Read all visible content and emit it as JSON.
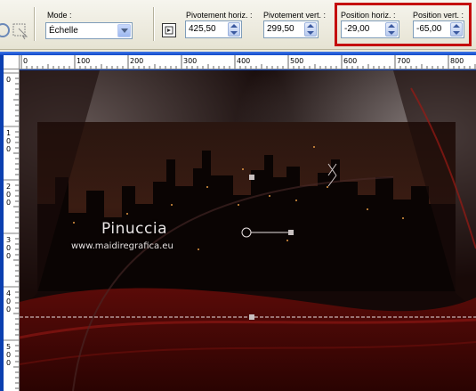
{
  "toolbar": {
    "mode": {
      "label": "Mode :",
      "value": "Échelle"
    },
    "pivot_h": {
      "label": "Pivotement horiz. :",
      "value": "425,50"
    },
    "pivot_v": {
      "label": "Pivotement vert. :",
      "value": "299,50"
    },
    "pos_h": {
      "label": "Position horiz. :",
      "value": "-29,00"
    },
    "pos_v": {
      "label": "Position vert. :",
      "value": "-65,00"
    },
    "highlight_color": "#c40d0d"
  },
  "ruler": {
    "horizontal": [
      "0",
      "100",
      "200",
      "300",
      "400",
      "500",
      "600",
      "700",
      "800"
    ],
    "vertical": [
      "0",
      "100",
      "200",
      "300",
      "400",
      "500"
    ]
  },
  "canvas": {
    "watermark_name": "Pinuccia",
    "watermark_url": "www.maidiregrafica.eu"
  }
}
